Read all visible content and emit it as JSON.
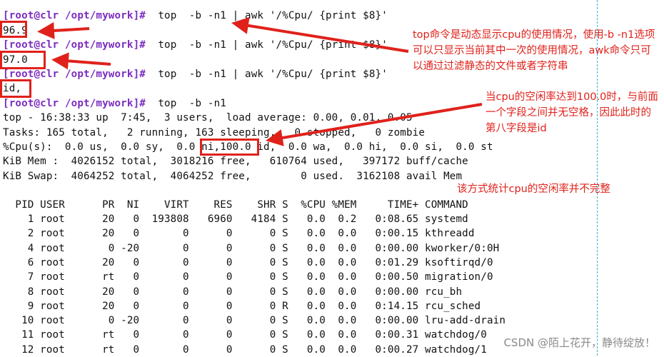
{
  "prompt": {
    "user": "root@clr",
    "path": "/opt/mywork"
  },
  "commands": [
    "top  -b -n1 | awk '/%Cpu/ {print $8}'",
    "top  -b -n1 | awk '/%Cpu/ {print $8}'",
    "top  -b -n1 | awk '/%Cpu/ {print $8}'",
    "top  -b -n1"
  ],
  "outputs": [
    "96.9",
    "97.0",
    "id,"
  ],
  "top_header": {
    "summary": "top - 16:38:33 up  7:45,  3 users,  load average: 0.00, 0.01, 0.05",
    "tasks": "Tasks: 165 total,   2 running, 163 sleeping,   0 stopped,   0 zombie",
    "cpu": "%Cpu(s):  0.0 us,  0.0 sy,  0.0 ni,100.0 id,  0.0 wa,  0.0 hi,  0.0 si,  0.0 st",
    "mem": "KiB Mem :  4026152 total,  3018216 free,   610764 used,   397172 buff/cache",
    "swap": "KiB Swap:  4064252 total,  4064252 free,        0 used.  3162108 avail Mem"
  },
  "process_table": {
    "header": "  PID USER      PR  NI    VIRT    RES    SHR S  %CPU %MEM     TIME+ COMMAND",
    "rows": [
      "    1 root      20   0  193808   6960   4184 S   0.0  0.2   0:08.65 systemd",
      "    2 root      20   0       0      0      0 S   0.0  0.0   0:00.15 kthreadd",
      "    4 root       0 -20       0      0      0 S   0.0  0.0   0:00.00 kworker/0:0H",
      "    6 root      20   0       0      0      0 S   0.0  0.0   0:01.29 ksoftirqd/0",
      "    7 root      rt   0       0      0      0 S   0.0  0.0   0:00.50 migration/0",
      "    8 root      20   0       0      0      0 S   0.0  0.0   0:00.00 rcu_bh",
      "    9 root      20   0       0      0      0 R   0.0  0.0   0:14.15 rcu_sched",
      "   10 root       0 -20       0      0      0 S   0.0  0.0   0:00.00 lru-add-drain",
      "   11 root      rt   0       0      0      0 S   0.0  0.0   0:00.31 watchdog/0",
      "   12 root      rt   0       0      0      0 S   0.0  0.0   0:00.27 watchdog/1"
    ]
  },
  "annotations": {
    "note1": "top命令是动态显示cpu的使用情况，使用-b -n1选项可以只显示当前其中一次的使用情况，awk命令只可以通过过滤静态的文件或者字符串",
    "note2": "当cpu的空闲率达到100.0时，与前面一个字段之间并无空格，因此此时的第八字段是id",
    "note3": "该方式统计cpu的空闲率并不完整"
  },
  "watermark": "CSDN @陌上花开，静待绽放！",
  "colors": {
    "prompt": "#7b2cbf",
    "annotation": "#e0211b",
    "divider": "#3fa9c9"
  }
}
